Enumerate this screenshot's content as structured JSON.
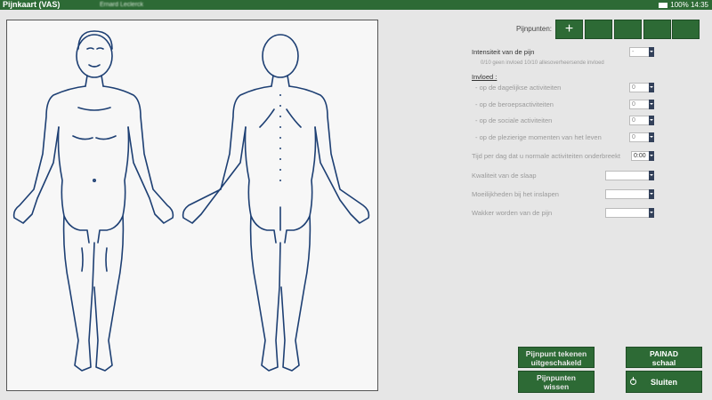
{
  "app": {
    "title": "Pijnkaart (VAS)",
    "patient": "Ernard Leclerck"
  },
  "status": {
    "battery": "100%",
    "time": "14:35"
  },
  "pain_points": {
    "label": "Pijnpunten:",
    "add_label": "+"
  },
  "intensity": {
    "label": "Intensiteit van de pijn",
    "value": "-",
    "hint": "0/10 geen invloed   10/10 allesoverheersende invloed"
  },
  "influence": {
    "heading": "Invloed :",
    "items": [
      {
        "label": "- op de dagelijkse activiteiten",
        "value": "0"
      },
      {
        "label": "- op de beroepsactiviteiten",
        "value": "0"
      },
      {
        "label": "- op de sociale activiteiten",
        "value": "0"
      },
      {
        "label": "- op de plezierige momenten van het leven",
        "value": "0"
      }
    ]
  },
  "time_interrupted": {
    "label": "Tijd per dag dat u normale activiteiten onderbreekt",
    "value": "0:00"
  },
  "sleep": [
    {
      "label": "Kwaliteit van de slaap",
      "value": ""
    },
    {
      "label": "Moeilijkheden bij het inslapen",
      "value": ""
    },
    {
      "label": "Wakker worden van de pijn",
      "value": ""
    }
  ],
  "buttons": {
    "draw_line1": "Pijnpunt tekenen",
    "draw_line2": "uitgeschakeld",
    "clear_line1": "Pijnpunten",
    "clear_line2": "wissen",
    "painad_line1": "PAINAD",
    "painad_line2": "schaal",
    "close": "Sluiten"
  },
  "colors": {
    "accent": "#2d6a35",
    "body_outline": "#1d3f73"
  }
}
